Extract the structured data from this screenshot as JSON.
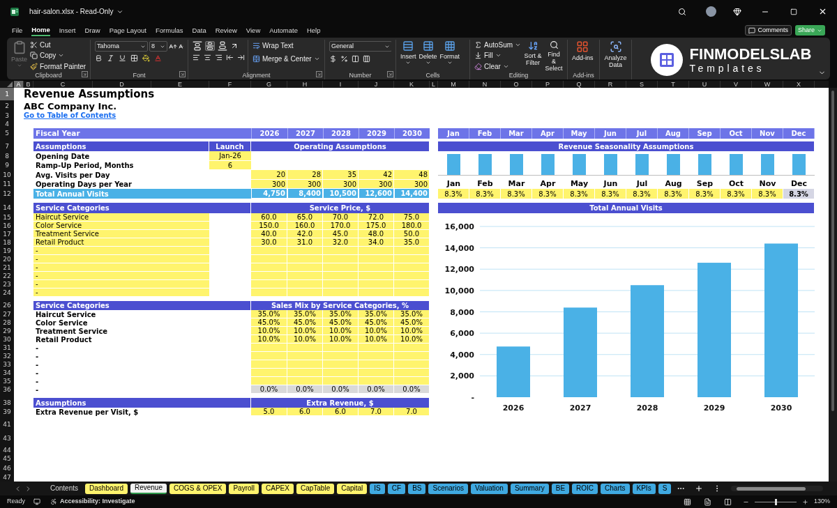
{
  "title_bar": {
    "title": "hair-salon.xlsx - Read-Only"
  },
  "menu": [
    {
      "label": "File",
      "selected": false
    },
    {
      "label": "Home",
      "selected": true
    },
    {
      "label": "Insert",
      "selected": false
    },
    {
      "label": "Draw",
      "selected": false
    },
    {
      "label": "Page Layout",
      "selected": false
    },
    {
      "label": "Formulas",
      "selected": false
    },
    {
      "label": "Data",
      "selected": false
    },
    {
      "label": "Review",
      "selected": false
    },
    {
      "label": "View",
      "selected": false
    },
    {
      "label": "Automate",
      "selected": false
    },
    {
      "label": "Help",
      "selected": false
    }
  ],
  "actions": {
    "comments": "Comments",
    "share": "Share"
  },
  "ribbon": {
    "clipboard": {
      "label": "Clipboard",
      "paste": "Paste",
      "paste_disabled": true,
      "cut": "Cut",
      "copy": "Copy",
      "format_painter": "Format Painter"
    },
    "font": {
      "label": "Font",
      "family": "Tahoma",
      "size": "8"
    },
    "alignment": {
      "label": "Alignment",
      "vertical": [
        {
          "selected": false
        },
        {
          "selected": true
        },
        {
          "selected": false
        }
      ],
      "wrap_text": "Wrap Text",
      "merge": "Merge & Center"
    },
    "number": {
      "label": "Number",
      "format": "General"
    },
    "cells": {
      "label": "Cells",
      "buttons": [
        "Insert",
        "Delete",
        "Format"
      ]
    },
    "editing": {
      "label": "Editing",
      "autosum": "AutoSum",
      "fill": "Fill",
      "clear": "Clear",
      "sort_filter": "Sort & Filter",
      "find_select": "Find & Select"
    },
    "add_ins": {
      "label": "Add-ins",
      "button": "Add-ins"
    },
    "analyze": {
      "button": "Analyze Data"
    }
  },
  "logo": {
    "name": "FINMODELSLAB",
    "tagline": "Templates"
  },
  "columns": [
    {
      "label": "A",
      "selected": true
    },
    {
      "label": "B",
      "selected": false
    },
    {
      "label": "C",
      "selected": false
    },
    {
      "label": "D",
      "selected": false
    },
    {
      "label": "E",
      "selected": false
    },
    {
      "label": "F",
      "selected": false
    },
    {
      "label": "G",
      "selected": false
    },
    {
      "label": "H",
      "selected": false
    },
    {
      "label": "I",
      "selected": false
    },
    {
      "label": "J",
      "selected": false
    },
    {
      "label": "K",
      "selected": false
    },
    {
      "label": "L",
      "selected": false
    },
    {
      "label": "M",
      "selected": false
    },
    {
      "label": "N",
      "selected": false
    },
    {
      "label": "O",
      "selected": false
    },
    {
      "label": "P",
      "selected": false
    },
    {
      "label": "Q",
      "selected": false
    },
    {
      "label": "R",
      "selected": false
    },
    {
      "label": "S",
      "selected": false
    },
    {
      "label": "T",
      "selected": false
    },
    {
      "label": "U",
      "selected": false
    },
    {
      "label": "V",
      "selected": false
    },
    {
      "label": "W",
      "selected": false
    },
    {
      "label": "X",
      "selected": false
    }
  ],
  "rows": [
    {
      "label": "1",
      "selected": true
    },
    {
      "label": "2",
      "selected": false
    },
    {
      "label": "3",
      "selected": false
    },
    {
      "label": "4",
      "selected": false
    },
    {
      "label": "5",
      "selected": false
    },
    {
      "label": "7",
      "selected": false
    },
    {
      "label": "8",
      "selected": false
    },
    {
      "label": "9",
      "selected": false
    },
    {
      "label": "10",
      "selected": false
    },
    {
      "label": "11",
      "selected": false
    },
    {
      "label": "12",
      "selected": false
    },
    {
      "label": "14",
      "selected": false
    },
    {
      "label": "15",
      "selected": false
    },
    {
      "label": "16",
      "selected": false
    },
    {
      "label": "17",
      "selected": false
    },
    {
      "label": "18",
      "selected": false
    },
    {
      "label": "19",
      "selected": false
    },
    {
      "label": "20",
      "selected": false
    },
    {
      "label": "21",
      "selected": false
    },
    {
      "label": "22",
      "selected": false
    },
    {
      "label": "23",
      "selected": false
    },
    {
      "label": "24",
      "selected": false
    },
    {
      "label": "26",
      "selected": false
    },
    {
      "label": "27",
      "selected": false
    },
    {
      "label": "28",
      "selected": false
    },
    {
      "label": "29",
      "selected": false
    },
    {
      "label": "30",
      "selected": false
    },
    {
      "label": "31",
      "selected": false
    },
    {
      "label": "32",
      "selected": false
    },
    {
      "label": "33",
      "selected": false
    },
    {
      "label": "34",
      "selected": false
    },
    {
      "label": "35",
      "selected": false
    },
    {
      "label": "36",
      "selected": false
    },
    {
      "label": "38",
      "selected": false
    },
    {
      "label": "39",
      "selected": false
    },
    {
      "label": "41",
      "selected": false
    },
    {
      "label": "43",
      "selected": false
    },
    {
      "label": "44",
      "selected": false
    },
    {
      "label": "45",
      "selected": false
    },
    {
      "label": "46",
      "selected": false
    },
    {
      "label": "47",
      "selected": false
    }
  ],
  "sheet": {
    "title": "Revenue Assumptions",
    "company": "ABC Company Inc.",
    "link": "Go to Table of Contents",
    "fiscal_year": {
      "label": "Fiscal Year",
      "years": [
        "2026",
        "2027",
        "2028",
        "2029",
        "2030"
      ]
    },
    "assumptions": {
      "headers": [
        "Assumptions",
        "Launch",
        "Operating Assumptions"
      ],
      "rows": [
        {
          "label": "Opening Date",
          "launch": "Jan-26"
        },
        {
          "label": "Ramp-Up Period, Months",
          "launch": "6"
        },
        {
          "label": "Avg. Visits per Day",
          "values": [
            "20",
            "28",
            "35",
            "42",
            "48"
          ]
        },
        {
          "label": "Operating Days per Year",
          "values": [
            "300",
            "300",
            "300",
            "300",
            "300"
          ]
        }
      ],
      "total": {
        "label": "Total Annual Visits",
        "values": [
          "4,750",
          "8,400",
          "10,500",
          "12,600",
          "14,400"
        ]
      }
    },
    "service_price": {
      "headers": [
        "Service Categories",
        "Service Price, $"
      ],
      "rows": [
        {
          "label": "Haircut Service",
          "values": [
            "60.0",
            "65.0",
            "70.0",
            "72.0",
            "75.0"
          ]
        },
        {
          "label": "Color Service",
          "values": [
            "150.0",
            "160.0",
            "170.0",
            "175.0",
            "180.0"
          ]
        },
        {
          "label": "Treatment Service",
          "values": [
            "40.0",
            "42.0",
            "45.0",
            "48.0",
            "50.0"
          ]
        },
        {
          "label": "Retail Product",
          "values": [
            "30.0",
            "31.0",
            "32.0",
            "34.0",
            "35.0"
          ]
        },
        {
          "label": "-"
        },
        {
          "label": "-"
        },
        {
          "label": "-"
        },
        {
          "label": "-"
        },
        {
          "label": "-"
        },
        {
          "label": "-"
        }
      ]
    },
    "sales_mix": {
      "headers": [
        "Service Categories",
        "Sales Mix by Service Categories, %"
      ],
      "rows": [
        {
          "label": "Haircut Service",
          "values": [
            "35.0%",
            "35.0%",
            "35.0%",
            "35.0%",
            "35.0%"
          ]
        },
        {
          "label": "Color Service",
          "values": [
            "45.0%",
            "45.0%",
            "45.0%",
            "45.0%",
            "45.0%"
          ]
        },
        {
          "label": "Treatment Service",
          "values": [
            "10.0%",
            "10.0%",
            "10.0%",
            "10.0%",
            "10.0%"
          ]
        },
        {
          "label": "Retail Product",
          "values": [
            "10.0%",
            "10.0%",
            "10.0%",
            "10.0%",
            "10.0%"
          ]
        },
        {
          "label": "-"
        },
        {
          "label": "-"
        },
        {
          "label": "-"
        },
        {
          "label": "-"
        },
        {
          "label": "-"
        }
      ],
      "total": {
        "label": "-",
        "values": [
          "0.0%",
          "0.0%",
          "0.0%",
          "0.0%",
          "0.0%"
        ]
      }
    },
    "extra_revenue": {
      "headers": [
        "Assumptions",
        "Extra Revenue, $"
      ],
      "rows": [
        {
          "label": "Extra Revenue per Visit, $",
          "values": [
            "5.0",
            "6.0",
            "6.0",
            "7.0",
            "7.0"
          ]
        }
      ]
    }
  },
  "seasonality": {
    "months": [
      "Jan",
      "Feb",
      "Mar",
      "Apr",
      "May",
      "Jun",
      "Jul",
      "Aug",
      "Sep",
      "Oct",
      "Nov",
      "Dec"
    ],
    "title": "Revenue Seasonality Assumptions",
    "shares": [
      {
        "month": "Jan",
        "share": "8.3%",
        "computed": false
      },
      {
        "month": "Feb",
        "share": "8.3%",
        "computed": false
      },
      {
        "month": "Mar",
        "share": "8.3%",
        "computed": false
      },
      {
        "month": "Apr",
        "share": "8.3%",
        "computed": false
      },
      {
        "month": "May",
        "share": "8.3%",
        "computed": false
      },
      {
        "month": "Jun",
        "share": "8.3%",
        "computed": false
      },
      {
        "month": "Jul",
        "share": "8.3%",
        "computed": false
      },
      {
        "month": "Aug",
        "share": "8.3%",
        "computed": false
      },
      {
        "month": "Sep",
        "share": "8.3%",
        "computed": false
      },
      {
        "month": "Oct",
        "share": "8.3%",
        "computed": false
      },
      {
        "month": "Nov",
        "share": "8.3%",
        "computed": false
      },
      {
        "month": "Dec",
        "share": "8.3%",
        "computed": true
      }
    ]
  },
  "visits_chart": {
    "title": "Total Annual Visits",
    "chart_data": {
      "type": "bar",
      "categories": [
        "2026",
        "2027",
        "2028",
        "2029",
        "2030"
      ],
      "values": [
        4750,
        8400,
        10500,
        12600,
        14400
      ],
      "grid": true,
      "ylim": [
        0,
        16000
      ],
      "yticks": [
        {
          "value": 0,
          "label": "-"
        },
        {
          "value": 2000,
          "label": "2,000"
        },
        {
          "value": 4000,
          "label": "4,000"
        },
        {
          "value": 6000,
          "label": "6,000"
        },
        {
          "value": 8000,
          "label": "8,000"
        },
        {
          "value": 10000,
          "label": "10,000"
        },
        {
          "value": 12000,
          "label": "12,000"
        },
        {
          "value": 14000,
          "label": "14,000"
        },
        {
          "value": 16000,
          "label": "16,000"
        }
      ]
    }
  },
  "sheet_tabs": [
    {
      "label": "Contents",
      "selected": false
    },
    {
      "label": "Dashboard",
      "color": "#fff36d",
      "selected": false
    },
    {
      "label": "Revenue",
      "selected": true
    },
    {
      "label": "COGS & OPEX",
      "color": "#fff36d",
      "selected": false
    },
    {
      "label": "Payroll",
      "color": "#fff36d",
      "selected": false
    },
    {
      "label": "CAPEX",
      "color": "#fff36d",
      "selected": false
    },
    {
      "label": "CapTable",
      "color": "#fff36d",
      "selected": false
    },
    {
      "label": "Capital",
      "color": "#fff36d",
      "selected": false
    },
    {
      "label": "IS",
      "color": "#3fa9e1",
      "selected": false
    },
    {
      "label": "CF",
      "color": "#3fa9e1",
      "selected": false
    },
    {
      "label": "BS",
      "color": "#3fa9e1",
      "selected": false
    },
    {
      "label": "Scenarios",
      "color": "#3fa9e1",
      "selected": false
    },
    {
      "label": "Valuation",
      "color": "#3fa9e1",
      "selected": false
    },
    {
      "label": "Summary",
      "color": "#3fa9e1",
      "selected": false
    },
    {
      "label": "BE",
      "color": "#3fa9e1",
      "selected": false
    },
    {
      "label": "ROIC",
      "color": "#3fa9e1",
      "selected": false
    },
    {
      "label": "Charts",
      "color": "#3fa9e1",
      "selected": false
    },
    {
      "label": "KPIs",
      "color": "#3fa9e1",
      "selected": false
    },
    {
      "label": "S",
      "color": "#3fa9e1",
      "selected": false
    }
  ],
  "status_bar": {
    "status": "Ready",
    "accessibility": "Accessibility: Investigate",
    "zoom": {
      "level": 0.5,
      "reading": "130%"
    }
  }
}
